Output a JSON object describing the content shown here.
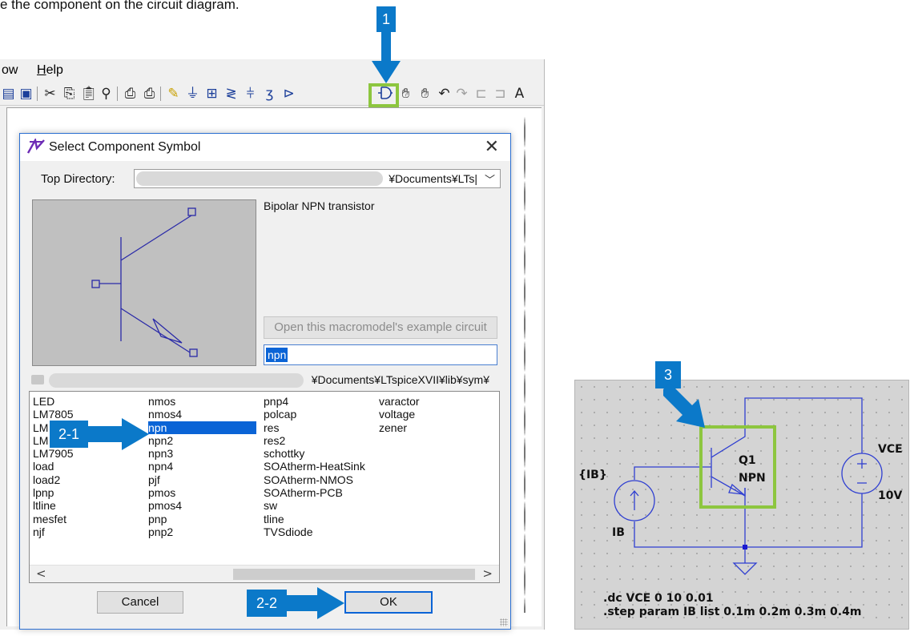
{
  "caption": "e the component on the circuit diagram.",
  "app": {
    "menu": [
      {
        "label": "ow",
        "underline": ""
      },
      {
        "label": "elp",
        "underline": "H"
      }
    ],
    "toolbar_icons": [
      "window-tile-icon",
      "window-cascade-icon",
      "cut-icon",
      "copy-icon",
      "paste-icon",
      "find-icon",
      "print-setup-icon",
      "print-icon",
      "draw-wire-icon",
      "ground-icon",
      "label-net-icon",
      "resistor-icon",
      "capacitor-icon",
      "inductor-icon",
      "diode-icon",
      "component-icon",
      "move-icon",
      "drag-icon",
      "undo-icon",
      "redo-icon",
      "rotate-icon",
      "mirror-icon",
      "text-icon"
    ]
  },
  "dialog": {
    "title": "Select Component Symbol",
    "top_directory_label": "Top Directory:",
    "top_directory_value": "¥Documents¥LTs|",
    "description": "Bipolar NPN transistor",
    "example_button": "Open this macromodel's example circuit",
    "search_value": "npn",
    "path_text": "¥Documents¥LTspiceXVII¥lib¥sym¥",
    "columns": [
      [
        "LED",
        "LM7805",
        "LM",
        "LM",
        "LM7905",
        "load",
        "load2",
        "lpnp",
        "ltline",
        "mesfet",
        "njf"
      ],
      [
        "nmos",
        "nmos4",
        "npn",
        "npn2",
        "npn3",
        "npn4",
        "pjf",
        "pmos",
        "pmos4",
        "pnp",
        "pnp2"
      ],
      [
        "pnp4",
        "polcap",
        "res",
        "res2",
        "schottky",
        "SOAtherm-HeatSink",
        "SOAtherm-NMOS",
        "SOAtherm-PCB",
        "sw",
        "tline",
        "TVSdiode"
      ],
      [
        "varactor",
        "voltage",
        "zener"
      ]
    ],
    "selected_item": "npn",
    "scroll_left": "<",
    "scroll_right": ">",
    "cancel_label": "Cancel",
    "ok_label": "OK"
  },
  "callouts": {
    "step1": "1",
    "step2_1": "2-1",
    "step2_2": "2-2",
    "step3": "3",
    "accent_color": "#0b79c9",
    "highlight_color": "#8dc63f"
  },
  "schematic": {
    "labels": {
      "current_param": "{IB}",
      "current_name": "IB",
      "transistor_name": "Q1",
      "transistor_model": "NPN",
      "voltage_name": "VCE",
      "voltage_value": "10V"
    },
    "directives": [
      ".dc VCE 0 10 0.01",
      ".step param IB list 0.1m 0.2m 0.3m 0.4m"
    ],
    "wire_color": "#2f3fd1"
  }
}
